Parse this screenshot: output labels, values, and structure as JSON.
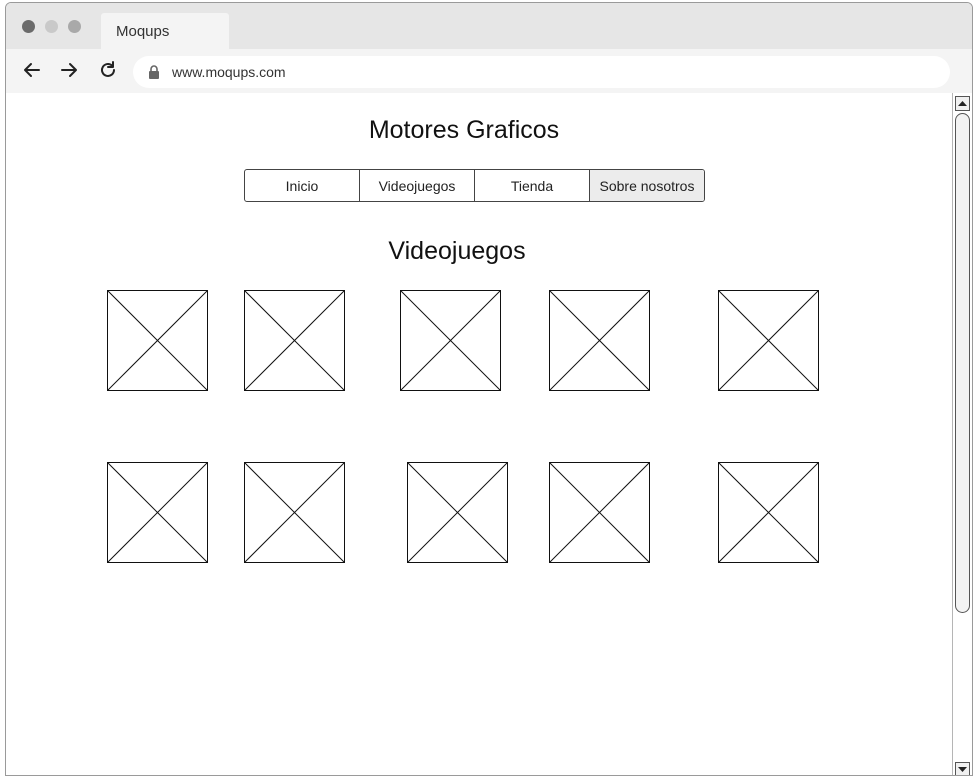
{
  "browser": {
    "tab_title": "Moqups",
    "url": "www.moqups.com",
    "icons": {
      "back": "arrow-left-icon",
      "forward": "arrow-right-icon",
      "reload": "reload-icon",
      "lock": "lock-icon"
    }
  },
  "page": {
    "site_title": "Motores Graficos",
    "menu": [
      {
        "label": "Inicio",
        "active": false
      },
      {
        "label": "Videojuegos",
        "active": false
      },
      {
        "label": "Tienda",
        "active": false
      },
      {
        "label": "Sobre nosotros",
        "active": true
      }
    ],
    "section_title": "Videojuegos",
    "image_placeholder_count": 10
  }
}
